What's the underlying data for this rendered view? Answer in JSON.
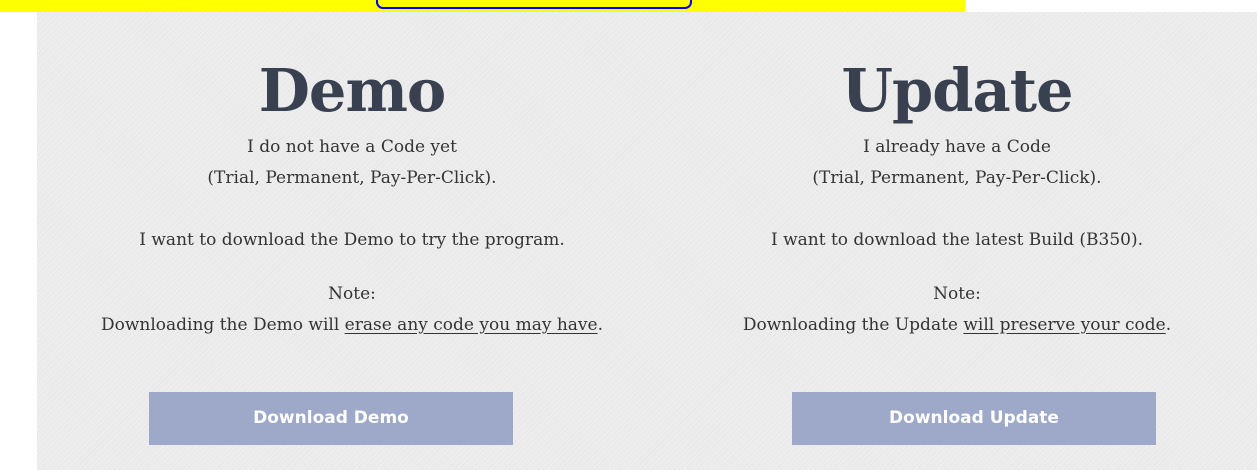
{
  "colors": {
    "top_highlight": "#ffff00",
    "top_link": "#0000ee",
    "panel_background": "#ebebeb",
    "title_text": "#394150",
    "body_text": "#333333",
    "button_background": "#9ea9c9",
    "button_text": "#ffffff"
  },
  "demo": {
    "title": "Demo",
    "line_1": "I do not have a Code yet",
    "line_2": "(Trial, Permanent, Pay-Per-Click).",
    "line_3": "I want to download the Demo to try the program.",
    "note_label": "Note:",
    "note_prefix": "Downloading the Demo will ",
    "note_emphasis": "erase any code you may have",
    "note_suffix": ".",
    "button_label": "Download Demo"
  },
  "update": {
    "title": "Update",
    "line_1": "I already have a Code",
    "line_2": "(Trial, Permanent, Pay-Per-Click).",
    "line_3": "I want to download the latest Build (B350).",
    "note_label": "Note:",
    "note_prefix": "Downloading the Update ",
    "note_emphasis": "will preserve your code",
    "note_suffix": ".",
    "button_label": "Download Update"
  }
}
